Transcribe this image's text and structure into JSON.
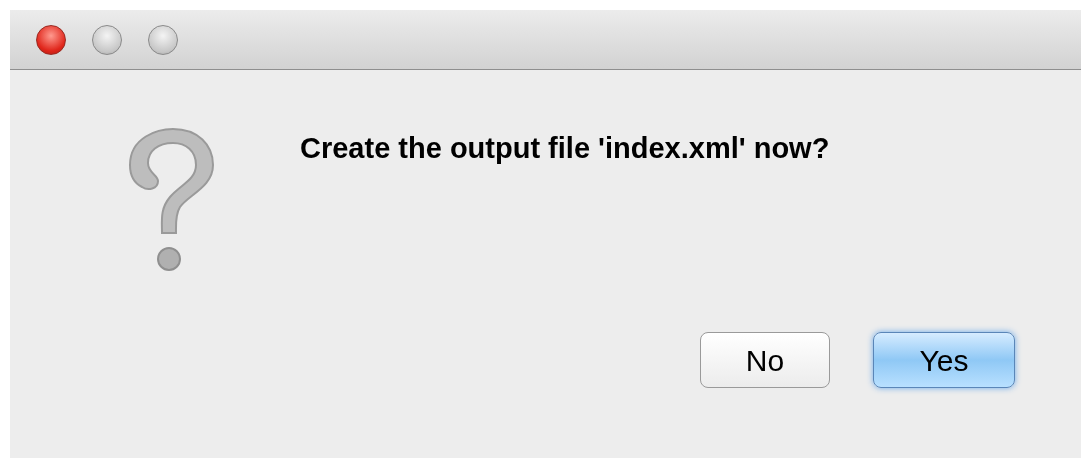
{
  "dialog": {
    "message": "Create the output file 'index.xml' now?"
  },
  "buttons": [
    {
      "label": "No",
      "default": false
    },
    {
      "label": "Yes",
      "default": true
    }
  ]
}
